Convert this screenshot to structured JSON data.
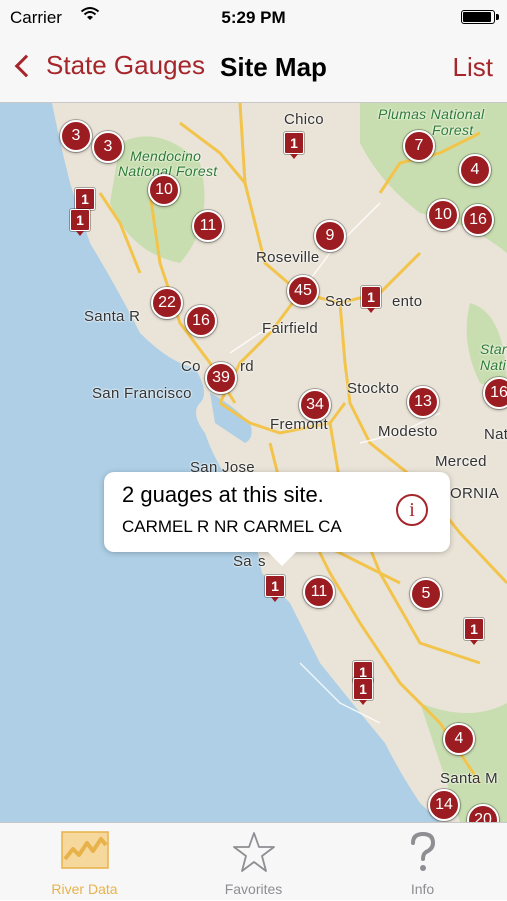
{
  "status_bar": {
    "carrier": "Carrier",
    "time": "5:29 PM"
  },
  "nav": {
    "back_label": "State Gauges",
    "title": "Site Map",
    "list_label": "List"
  },
  "map": {
    "place_labels": {
      "chico": "Chico",
      "plumas_line1": "Plumas National",
      "plumas_line2": "Forest",
      "mendocino_line1": "Mendocino",
      "mendocino_line2": "National Forest",
      "roseville": "Roseville",
      "santa_rosa": "Santa R",
      "sacramento_a": "Sac",
      "sacramento_b": "ento",
      "fairfield": "Fairfield",
      "concord": "Co",
      "concord_b": "rd",
      "stockton": "Stockto",
      "san_francisco": "San Francisco",
      "fremont": "Fremont",
      "modesto": "Modesto",
      "merced": "Merced",
      "san_jose": "San Jose",
      "salinas": "Sa",
      "salinas_b": "s",
      "fornia": "ORNIA",
      "stan_line1": "Star",
      "stan_line2": "Nati",
      "nat": "Nat",
      "santa_maria": "Santa M"
    },
    "cluster_pins": [
      "3",
      "3",
      "10",
      "11",
      "9",
      "45",
      "22",
      "16",
      "39",
      "34",
      "13",
      "7",
      "4",
      "10",
      "16",
      "11",
      "5",
      "4",
      "14",
      "16",
      "20"
    ],
    "single_markers": [
      "1",
      "1",
      "1",
      "1",
      "1",
      "1",
      "1",
      "1"
    ]
  },
  "callout": {
    "title": "2 guages at this site.",
    "subtitle": "CARMEL R NR CARMEL CA",
    "info_glyph": "i"
  },
  "tabs": [
    {
      "label": "River Data",
      "icon": "chart-icon",
      "active": true
    },
    {
      "label": "Favorites",
      "icon": "star-icon",
      "active": false
    },
    {
      "label": "Info",
      "icon": "question-icon",
      "active": false
    }
  ],
  "colors": {
    "accent": "#a5262b",
    "pin": "#9b1d22",
    "tab_active": "#e8b24a",
    "water": "#aecfe6",
    "land": "#eae4d8",
    "forest": "#c9deb0"
  }
}
